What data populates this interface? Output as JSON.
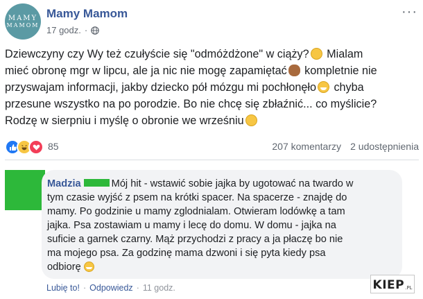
{
  "post": {
    "page_name": "Mamy Mamom",
    "avatar_text_top": "MAMY",
    "avatar_text_bottom": "MAMOM",
    "time": "17 godz.",
    "more_label": "···",
    "text_line1": "Dziewczyny czy Wy też czułyście się \"odmóżdżone\" w ciąży?",
    "text_line1b": " Mialam",
    "text_line2": "mieć obronę mgr w lipcu, ale ja nic nie mogę zapamiętać",
    "text_line2b": " kompletnie nie",
    "text_line3": "przyswajam informacji, jakby dziecko pół mózgu mi pochłonęło",
    "text_line3b": " chyba",
    "text_line4": "przesune wszystko na po porodzie. Bo nie chcę się zbłaźnić... co myślicie?",
    "text_line5": "Rodzę w sierpniu i myślę o obronie we wrześniu",
    "icons": {
      "globe": "globe-icon",
      "emoji1": "rolling-eyes-emoji",
      "emoji2": "see-no-evil-monkey-emoji",
      "emoji3": "grinning-emoji",
      "emoji4": "thinking-emoji"
    }
  },
  "reactions": {
    "count": "85",
    "comments": "207 komentarzy",
    "shares": "2 udostępnienia",
    "types": [
      "like",
      "haha",
      "love"
    ],
    "colors": {
      "like": "#2078f4",
      "haha": "#f7c644",
      "love": "#f33e58"
    }
  },
  "comment": {
    "author": "Madzia",
    "line1": "Mój hit - wstawić sobie jajka by ugotować na twardo w",
    "line2": "tym czasie wyjść z psem na krótki spacer. Na spacerze - znajdę do",
    "line3": "mamy. Po godzinie u mamy zglodnialam. Otwieram lodówkę a tam",
    "line4": "jajka. Psa zostawiam u mamy i lecę do domu. W domu - jajka na",
    "line5": "suficie a garnek czarny. Mąż przychodzi z pracy a ja płaczę bo nie",
    "line6": "ma mojego psa. Za godzinę mama dzwoni i się pyta kiedy psa",
    "line7": "odbiorę",
    "actions": {
      "like": "Lubię to!",
      "separator": "·",
      "reply": "Odpowiedz",
      "time": "11 godz."
    },
    "redaction_color": "#2db83a"
  },
  "watermark": {
    "main": "KIEP",
    "sub": ".PL"
  },
  "colors": {
    "link": "#385898",
    "muted": "#606770",
    "bubble": "#f2f3f5"
  }
}
